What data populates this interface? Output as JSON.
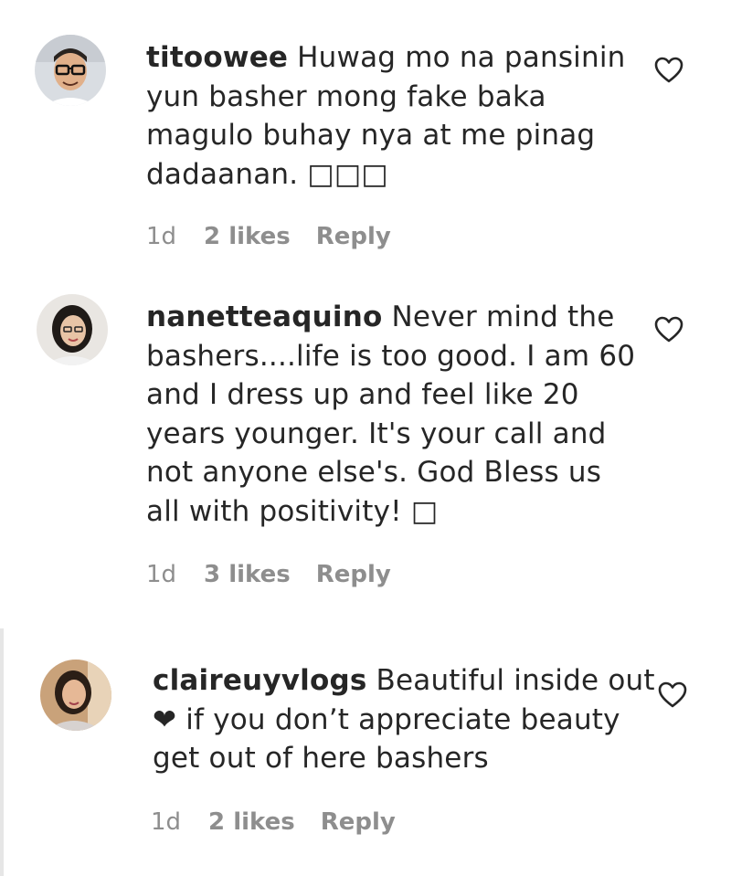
{
  "comments": [
    {
      "username": "titoowee",
      "text": "Huwag mo na pansinin yun basher mong fake baka magulo buhay nya at me pinag dadaanan. □□□",
      "lines": [
        "yun basher mong fake baka",
        "magulo buhay nya at me pinag",
        "dadaanan. □□□"
      ],
      "first_line": "Huwag mo na pansinin",
      "time": "1d",
      "likes": "2 likes",
      "reply": "Reply",
      "avatar_icon": "avatar-photo-man-glasses",
      "like_icon": "heart-outline-icon"
    },
    {
      "username": "nanetteaquino",
      "first_line": "Never mind the",
      "lines": [
        "bashers....life is too good. I am 60",
        "and I dress up and feel like 20",
        "years younger. It's your call and",
        "not anyone else's. God Bless us",
        "all with positivity! □"
      ],
      "time": "1d",
      "likes": "3 likes",
      "reply": "Reply",
      "avatar_icon": "avatar-photo-woman",
      "like_icon": "heart-outline-icon"
    },
    {
      "username": "claireuyvlogs",
      "first_line": "Beautiful inside out",
      "lines": [
        "❤ if you don’t appreciate beauty",
        "get out of here bashers"
      ],
      "time": "1d",
      "likes": "2 likes",
      "reply": "Reply",
      "avatar_icon": "avatar-photo-woman",
      "like_icon": "heart-outline-icon"
    }
  ],
  "colors": {
    "text": "#262626",
    "meta": "#8e8e8e"
  }
}
